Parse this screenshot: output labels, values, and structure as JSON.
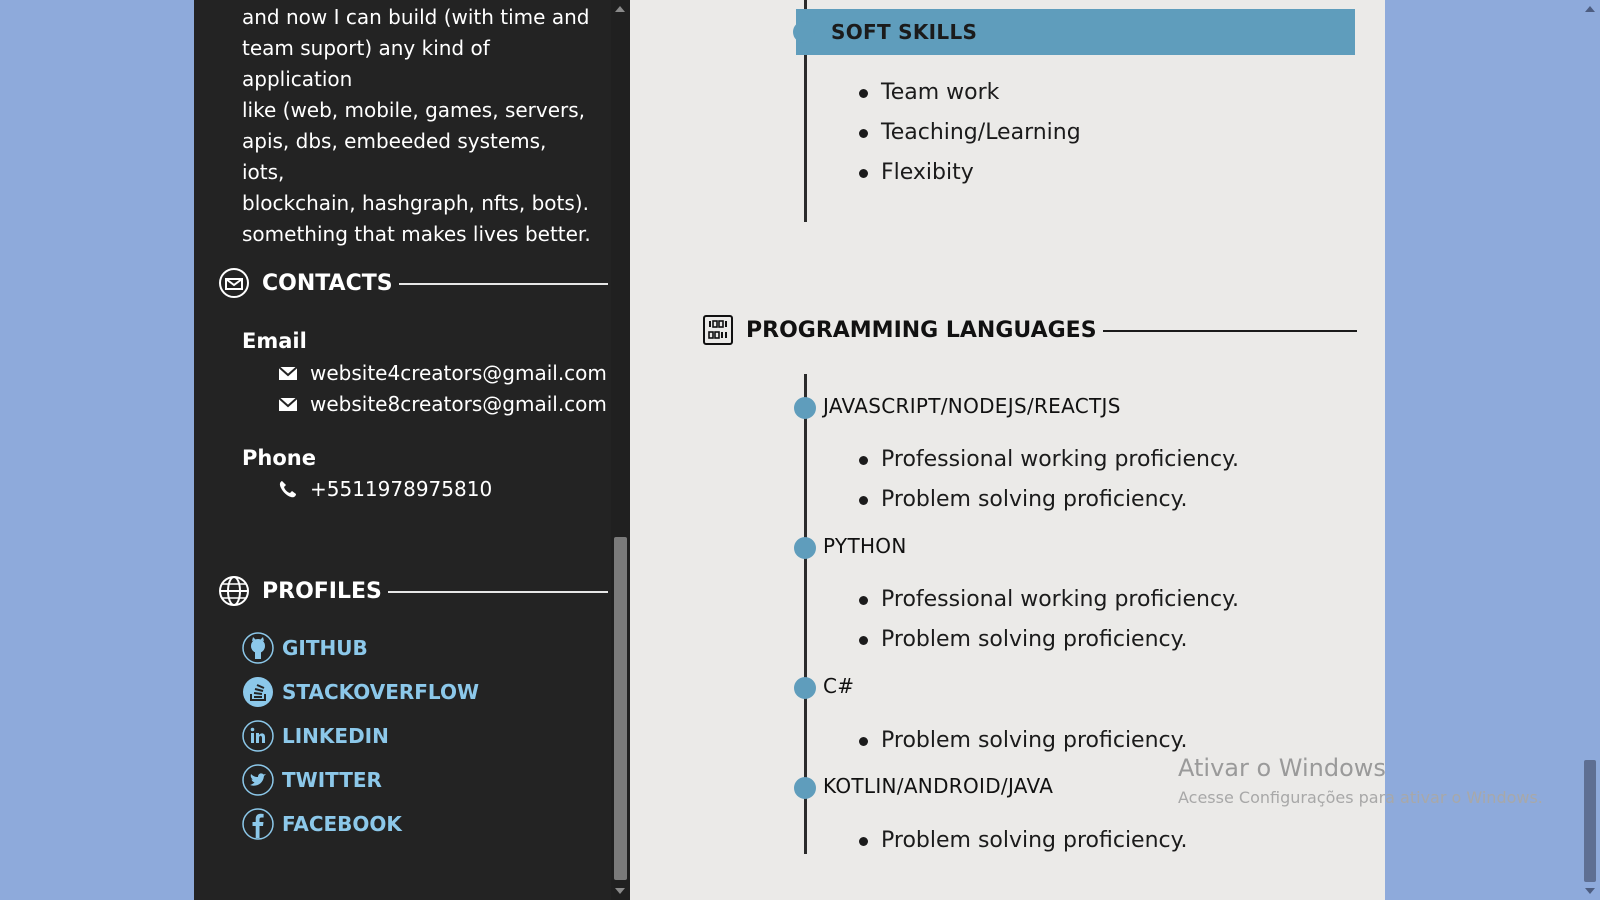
{
  "sidebar": {
    "about_lines": [
      "and now I can build (with time and",
      "team suport) any kind of application",
      "like (web, mobile, games, servers,",
      "apis, dbs, embeeded systems, iots,",
      "blockchain, hashgraph, nfts, bots).",
      "something that makes lives better."
    ],
    "contacts": {
      "title": "CONTACTS",
      "icon": "contact-envelope-icon",
      "email_label": "Email",
      "emails": [
        "website4creators@gmail.com",
        "website8creators@gmail.com"
      ],
      "phone_label": "Phone",
      "phones": [
        "+5511978975810"
      ]
    },
    "profiles": {
      "title": "PROFILES",
      "icon": "globe-icon",
      "items": [
        {
          "label": "GITHUB",
          "icon": "github-icon"
        },
        {
          "label": "STACKOVERFLOW",
          "icon": "stackoverflow-icon"
        },
        {
          "label": "LINKEDIN",
          "icon": "linkedin-icon"
        },
        {
          "label": "TWITTER",
          "icon": "twitter-icon"
        },
        {
          "label": "FACEBOOK",
          "icon": "facebook-icon"
        }
      ],
      "link_color": "#8cc8ea"
    }
  },
  "main": {
    "soft_skills": {
      "title": "SOFT SKILLS",
      "items": [
        "Team work",
        "Teaching/Learning",
        "Flexibity"
      ],
      "header_color": "#5f9dbc"
    },
    "programming_languages": {
      "title": "PROGRAMMING LANGUAGES",
      "icon": "binary-code-icon",
      "languages": [
        {
          "name": "JAVASCRIPT/NODEJS/REACTJS",
          "points": [
            "Professional working proficiency.",
            "Problem solving proficiency."
          ]
        },
        {
          "name": "PYTHON",
          "points": [
            "Professional working proficiency.",
            "Problem solving proficiency."
          ]
        },
        {
          "name": "C#",
          "points": [
            "Problem solving proficiency."
          ]
        },
        {
          "name": "KOTLIN/ANDROID/JAVA",
          "points": [
            "Problem solving proficiency."
          ]
        }
      ]
    }
  },
  "watermark": {
    "title": "Ativar o Windows",
    "subtitle": "Acesse Configurações para ativar o Windows."
  },
  "colors": {
    "page_background": "#8eaadb",
    "sidebar_background": "#232323",
    "content_background": "#ebeae8",
    "accent": "#5f9dbc"
  }
}
